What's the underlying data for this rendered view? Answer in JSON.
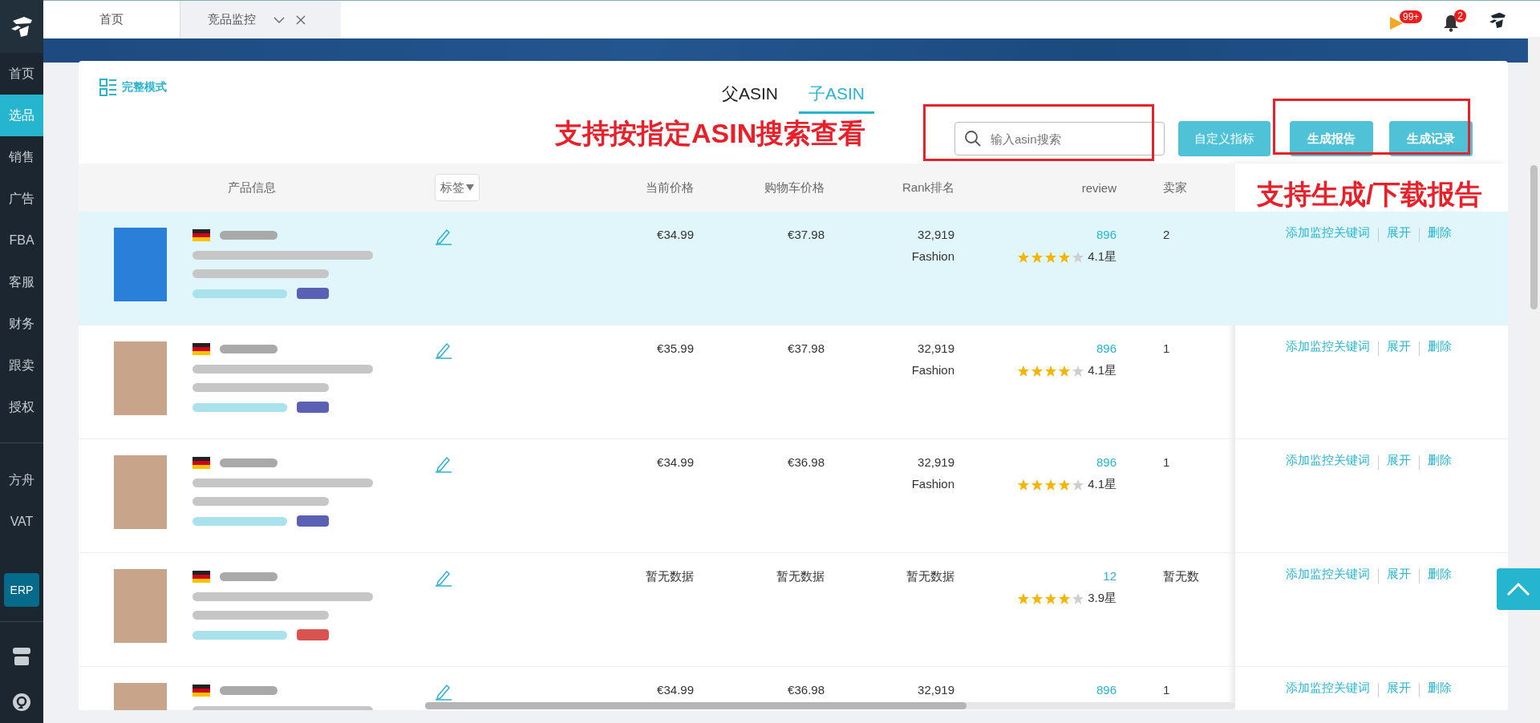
{
  "sidebar": {
    "items": [
      {
        "label": "首页",
        "selected": false
      },
      {
        "label": "选品",
        "selected": true
      },
      {
        "label": "销售",
        "selected": false
      },
      {
        "label": "广告",
        "selected": false
      },
      {
        "label": "FBA",
        "selected": false
      },
      {
        "label": "客服",
        "selected": false
      },
      {
        "label": "财务",
        "selected": false
      },
      {
        "label": "跟卖",
        "selected": false
      },
      {
        "label": "授权",
        "selected": false
      }
    ],
    "lower_items": [
      {
        "label": "方舟",
        "selected": false
      },
      {
        "label": "VAT",
        "selected": false
      }
    ],
    "erp_button": "ERP"
  },
  "tabs": [
    {
      "label": "首页",
      "selected": false
    },
    {
      "label": "竞品监控",
      "selected": true
    }
  ],
  "header": {
    "flag_badge": "99+",
    "bell_badge": "2"
  },
  "view_mode": "完整模式",
  "asin_tabs": [
    {
      "label": "父ASIN",
      "selected": false
    },
    {
      "label": "子ASIN",
      "selected": true
    }
  ],
  "search": {
    "placeholder": "输入asin搜索"
  },
  "buttons": [
    "自定义指标",
    "生成报告",
    "生成记录"
  ],
  "annotations": [
    "支持按指定ASIN搜索查看",
    "支持生成/下载报告"
  ],
  "table": {
    "columns": [
      "产品信息",
      "标签",
      "当前价格",
      "购物车价格",
      "Rank排名",
      "review",
      "卖家"
    ],
    "rows": [
      {
        "selected": true,
        "badge": {
          "color": "#5a60b4"
        },
        "price": "€34.99",
        "cart_price": "€37.98",
        "rank": "32,919",
        "category": "Fashion",
        "reviews": "896",
        "stars": 4,
        "rating": "4.1星",
        "sellers": "2",
        "actions": [
          "添加监控关键词",
          "展开",
          "删除"
        ]
      },
      {
        "selected": false,
        "badge": {
          "color": "#5a60b4"
        },
        "price": "€35.99",
        "cart_price": "€37.98",
        "rank": "32,919",
        "category": "Fashion",
        "reviews": "896",
        "stars": 4,
        "rating": "4.1星",
        "sellers": "1",
        "actions": [
          "添加监控关键词",
          "展开",
          "删除"
        ]
      },
      {
        "selected": false,
        "badge": {
          "color": "#5a60b4"
        },
        "price": "€34.99",
        "cart_price": "€36.98",
        "rank": "32,919",
        "category": "Fashion",
        "reviews": "896",
        "stars": 4,
        "rating": "4.1星",
        "sellers": "1",
        "actions": [
          "添加监控关键词",
          "展开",
          "删除"
        ]
      },
      {
        "selected": false,
        "badge": {
          "color": "#d9534f"
        },
        "price": "暂无数据",
        "cart_price": "暂无数据",
        "rank": "暂无数据",
        "reviews": "12",
        "stars": 4,
        "rating": "3.9星",
        "sellers": "暂无数",
        "actions": [
          "添加监控关键词",
          "展开",
          "删除"
        ]
      },
      {
        "selected": false,
        "price": "€34.99",
        "cart_price": "€36.98",
        "rank": "32,919",
        "reviews": "896",
        "sellers": "1",
        "actions": [
          "添加监控关键词",
          "展开",
          "删除"
        ]
      }
    ]
  }
}
